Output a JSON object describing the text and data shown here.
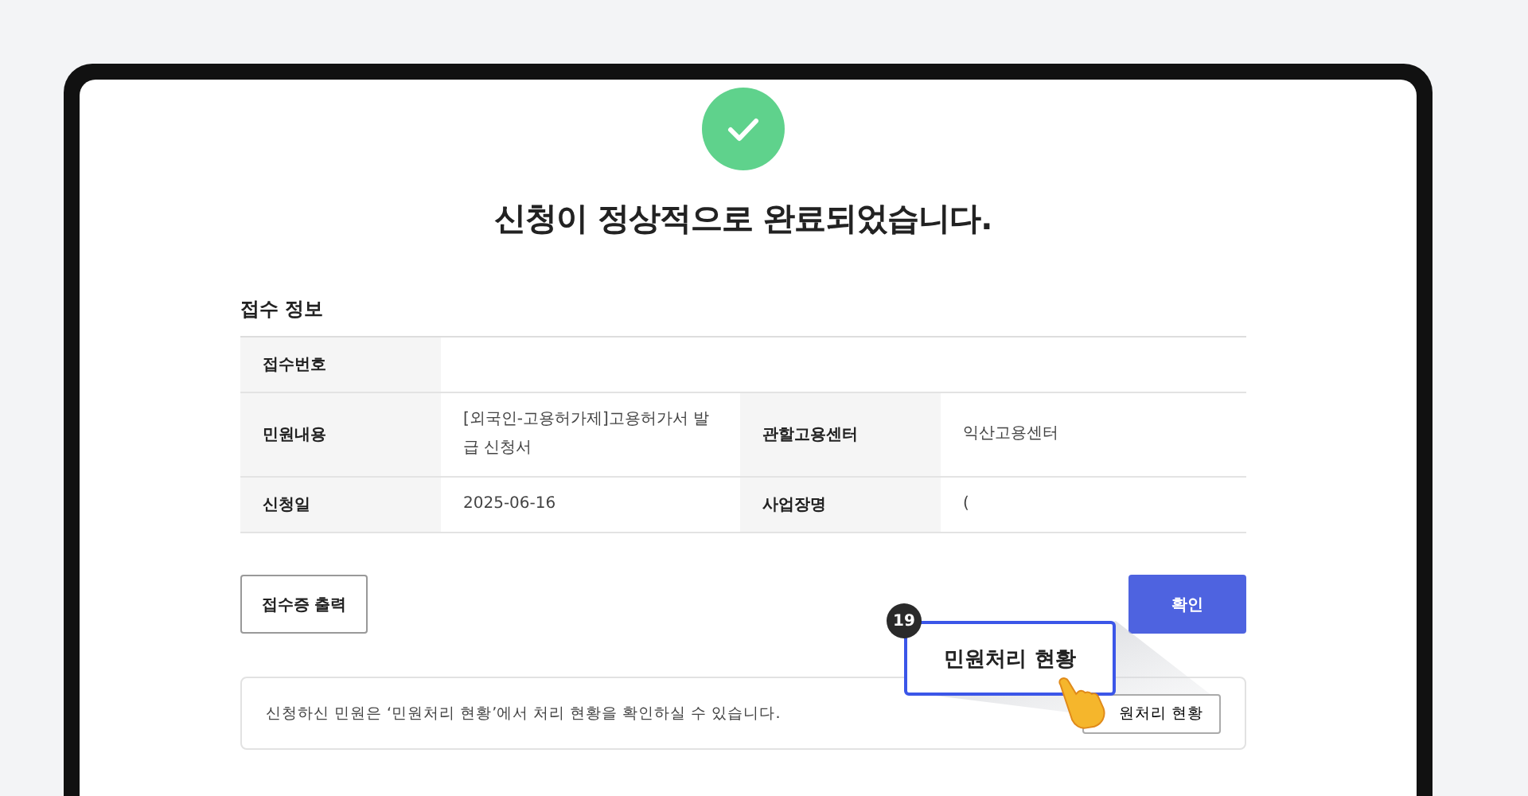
{
  "title": "신청이 정상적으로 완료되었습니다.",
  "section_title": "접수 정보",
  "info_rows": [
    {
      "cells": [
        {
          "label": "접수번호"
        }
      ]
    },
    {
      "cells": [
        {
          "label": "민원내용",
          "value": "[외국인-고용허가제]고용허가서 발급 신청서"
        },
        {
          "label": "관할고용센터",
          "value": "익산고용센터"
        }
      ]
    },
    {
      "cells": [
        {
          "label": "신청일",
          "value": "2025-06-16"
        },
        {
          "label": "사업장명",
          "value": "("
        }
      ]
    }
  ],
  "buttons": [
    {
      "label": "접수증 출력",
      "kind": "secondary"
    },
    {
      "label": "확인",
      "kind": "primary"
    }
  ],
  "notice": {
    "text": "신청하신 민원은 ‘민원처리 현황’에서 처리 현황을 확인하실 수 있습니다.",
    "button": "원처리 현황"
  },
  "callout": {
    "step": "19",
    "label": "민원처리 현황"
  }
}
